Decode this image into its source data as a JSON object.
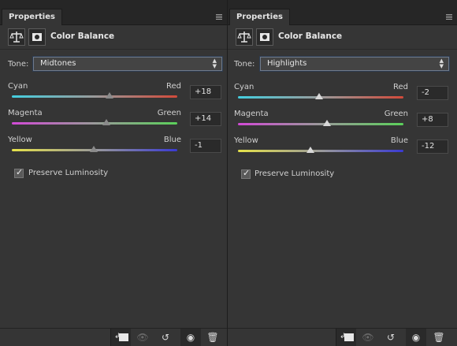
{
  "panels": [
    {
      "tab_label": "Properties",
      "title": "Color Balance",
      "tone_label": "Tone:",
      "tone_value": "Midtones",
      "sliders": [
        {
          "left": "Cyan",
          "right": "Red",
          "value": "+18",
          "numeric": 18
        },
        {
          "left": "Magenta",
          "right": "Green",
          "value": "+14",
          "numeric": 14
        },
        {
          "left": "Yellow",
          "right": "Blue",
          "value": "-1",
          "numeric": -1
        }
      ],
      "preserve_luminosity_label": "Preserve Luminosity",
      "preserve_luminosity_checked": true
    },
    {
      "tab_label": "Properties",
      "title": "Color Balance",
      "tone_label": "Tone:",
      "tone_value": "Highlights",
      "sliders": [
        {
          "left": "Cyan",
          "right": "Red",
          "value": "-2",
          "numeric": -2
        },
        {
          "left": "Magenta",
          "right": "Green",
          "value": "+8",
          "numeric": 8
        },
        {
          "left": "Yellow",
          "right": "Blue",
          "value": "-12",
          "numeric": -12
        }
      ],
      "preserve_luminosity_label": "Preserve Luminosity",
      "preserve_luminosity_checked": true
    }
  ],
  "slider_range": [
    -100,
    100
  ],
  "colors": {
    "cyan_red": [
      "#44cfe0",
      "#d24a3a"
    ],
    "magenta_green": [
      "#d24ad6",
      "#5bd05a"
    ],
    "yellow_blue": [
      "#e6e24a",
      "#3a3ad2"
    ],
    "select_border": "#6f7a8a"
  },
  "icons": {
    "header_adjustment": "scales-icon",
    "header_mask": "layer-mask-icon",
    "footer": [
      "clip-to-layer-icon",
      "view-previous-state-icon",
      "reset-icon",
      "visibility-icon",
      "delete-icon"
    ]
  }
}
